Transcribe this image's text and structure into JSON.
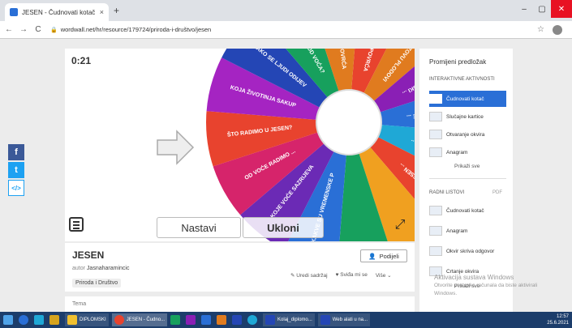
{
  "browser": {
    "tab_title": "JESEN - Čudnovati kotač",
    "tab_close": "×",
    "new_tab": "+",
    "url_domain": "wordwall.net",
    "url_path": "/hr/resource/179724/priroda-i-društvo/jesen",
    "win_min": "–",
    "win_max": "▢",
    "win_close": "✕",
    "nav_back": "←",
    "nav_forward": "→",
    "nav_reload": "C",
    "star": "☆"
  },
  "share": {
    "facebook": "f",
    "twitter": "t",
    "embed": "</>"
  },
  "game": {
    "timer": "0:21",
    "next_label": "Nastavi",
    "remove_label": "Ukloni",
    "fullscreen": "⤢",
    "segments": [
      {
        "label": "ŠTO RADIMO OD POVRĆA?",
        "color": "#e8432e"
      },
      {
        "label": "KAKO SE ZOVU PLODOVI ...",
        "color": "#e07b1f"
      },
      {
        "label": "ŠTO SU JESENSKI ...",
        "color": "#8a1fb5"
      },
      {
        "label": "KOJE SU JESENSKE ...",
        "color": "#2a6fd6"
      },
      {
        "label": "KAKO SE ZOVE ...",
        "color": "#1fa8d6"
      },
      {
        "label": "ŠTO JE JESEN ...",
        "color": "#e8432e"
      },
      {
        "label": "",
        "color": "#f0a020"
      },
      {
        "label": "",
        "color": "#17a05d"
      },
      {
        "label": "KAKVE SU VREMENSKE PRILIKE ...",
        "color": "#2a6fd6"
      },
      {
        "label": "KOJE VOĆE SAZRIJEVA ...",
        "color": "#6b2ab5"
      },
      {
        "label": "OD VOĆE RADIMO ...",
        "color": "#d6246b"
      },
      {
        "label": "ŠTO RADIMO U JESEN?",
        "color": "#e8432e"
      },
      {
        "label": "KOJA ŽIVOTINJA SAKUPLJA ZA ZIMU?",
        "color": "#a524c2"
      },
      {
        "label": "KAKO SE LJUDI ODIJEVAJU U JESEN?",
        "color": "#2446b5"
      },
      {
        "label": "ŠTO RADIMO OD VOĆA?",
        "color": "#17a05d"
      },
      {
        "label": "ŠTO RADIMO OD POVRĆA?",
        "color": "#e07b1f"
      }
    ]
  },
  "info": {
    "title": "JESEN",
    "author_label": "autor",
    "author": "Jasnaharamincic",
    "tag": "Priroda i Društvo",
    "share_button": "Podijeli",
    "edit": "Uredi sadržaj",
    "like": "Sviđa mi se",
    "more": "Više",
    "sub_card": "Tema"
  },
  "sidebar": {
    "heading": "Promijeni predložak",
    "interactive": "INTERAKTIVNE AKTIVNOSTI",
    "items": [
      {
        "label": "Čudnovati kotač"
      },
      {
        "label": "Slučajne kartice"
      },
      {
        "label": "Otvaranje okvira"
      },
      {
        "label": "Anagram"
      }
    ],
    "show_all": "Prikaži sve",
    "worksheets": "RADNI LISTOVI",
    "pdf": "PDF",
    "ws_items": [
      {
        "label": "Čudnovati kotač"
      },
      {
        "label": "Anagram"
      },
      {
        "label": "Okvir skriva odgovor"
      },
      {
        "label": "Crtanje okvira"
      }
    ],
    "show_all_2": "Prikaži sve"
  },
  "watermark": {
    "line1": "Aktivacija sustava Windows",
    "line2": "Otvorite postavke računala da biste aktivirali",
    "line3": "Windows."
  },
  "taskbar": {
    "diplomski": "DIPLOMSKI",
    "chrome_tab": "JESEN - Čudno...",
    "word1": "Kolaj_diplomo...",
    "word2": "Web alati u na...",
    "time": "12:57",
    "date": "25.6.2021"
  }
}
